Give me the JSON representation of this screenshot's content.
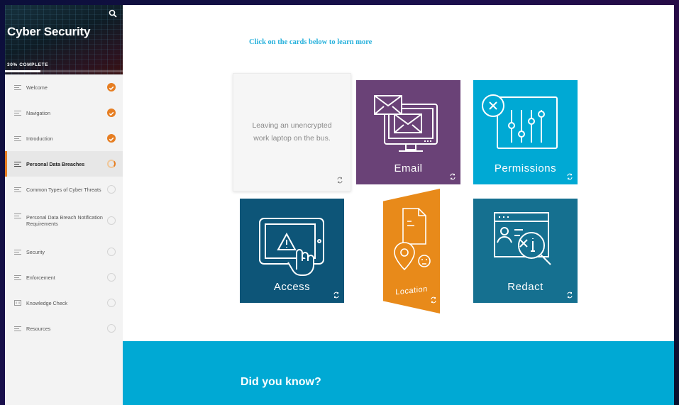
{
  "course": {
    "title": "Cyber Security",
    "progress_text": "30% COMPLETE",
    "progress_fraction": 0.3
  },
  "menu": [
    {
      "label": "Welcome",
      "status": "done"
    },
    {
      "label": "Navigation",
      "status": "done"
    },
    {
      "label": "Introduction",
      "status": "done"
    },
    {
      "label": "Personal Data Breaches",
      "status": "partial",
      "active": true
    },
    {
      "label": "Common Types of Cyber Threats",
      "status": "pending"
    },
    {
      "label": "Personal Data Breach Notification Requirements",
      "status": "pending"
    },
    {
      "label": "Security",
      "status": "pending"
    },
    {
      "label": "Enforcement",
      "status": "pending"
    },
    {
      "label": "Knowledge Check",
      "status": "pending"
    },
    {
      "label": "Resources",
      "status": "pending"
    }
  ],
  "main": {
    "prompt": "Click on the cards below to learn more",
    "cards": {
      "laptop_text": "Leaving an unencrypted work laptop on the bus.",
      "email": "Email",
      "permissions": "Permissions",
      "access": "Access",
      "location": "Location",
      "redact": "Redact"
    },
    "banner_title": "Did you know?"
  },
  "colors": {
    "accent": "#e67e22",
    "email": "#6a4277",
    "permissions": "#00a9d4",
    "access": "#0d5578",
    "location": "#e88a1a",
    "redact": "#157090",
    "banner": "#00a9d4"
  }
}
